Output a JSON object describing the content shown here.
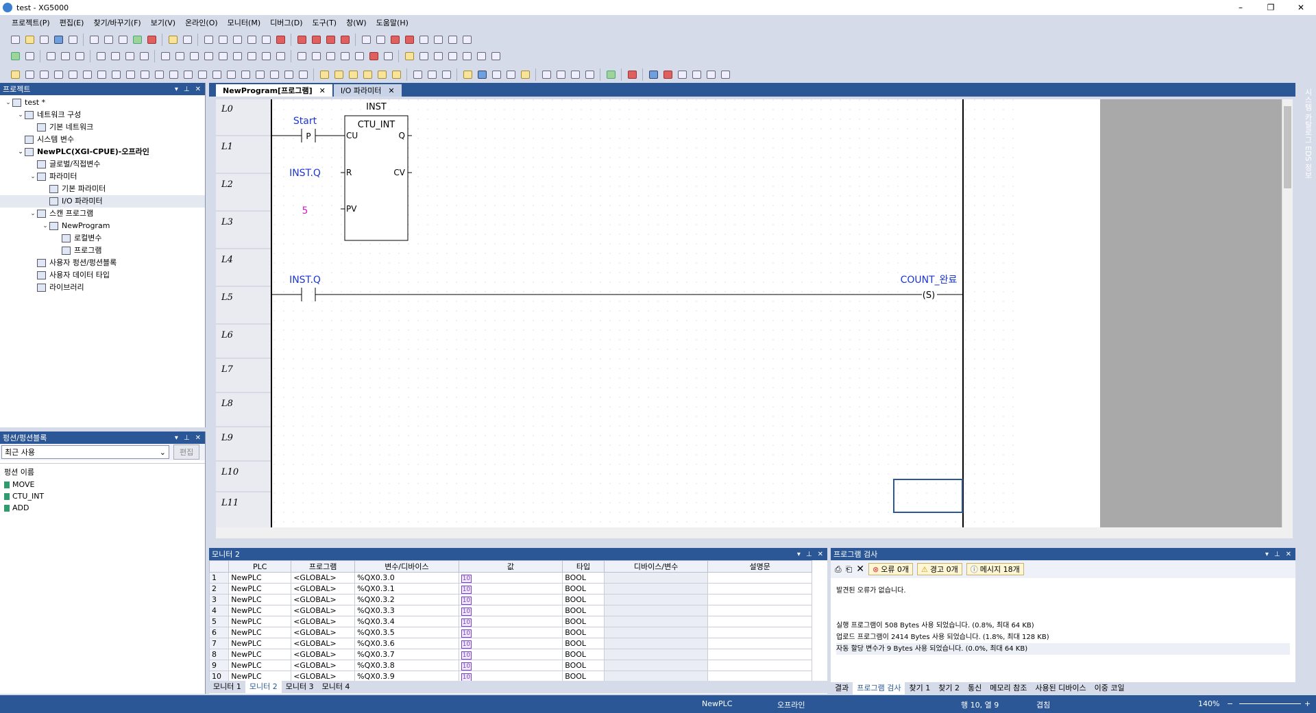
{
  "window": {
    "title": "test - XG5000",
    "controls": [
      "–",
      "❐",
      "✕"
    ]
  },
  "menu": [
    "프로젝트(P)",
    "편집(E)",
    "찾기/바꾸기(F)",
    "보기(V)",
    "온라인(O)",
    "모니터(M)",
    "디버그(D)",
    "도구(T)",
    "창(W)",
    "도움말(H)"
  ],
  "project_panel": {
    "title": "프로젝트",
    "tree": [
      {
        "label": "test *",
        "level": 0,
        "exp": "⌄"
      },
      {
        "label": "네트워크 구성",
        "level": 1,
        "exp": "⌄"
      },
      {
        "label": "기본 네트워크",
        "level": 2,
        "exp": ""
      },
      {
        "label": "시스템 변수",
        "level": 1,
        "exp": ""
      },
      {
        "label": "NewPLC(XGI-CPUE)-오프라인",
        "level": 1,
        "exp": "⌄",
        "bold": true
      },
      {
        "label": "글로벌/직접변수",
        "level": 2,
        "exp": ""
      },
      {
        "label": "파라미터",
        "level": 2,
        "exp": "⌄"
      },
      {
        "label": "기본 파라미터",
        "level": 3,
        "exp": ""
      },
      {
        "label": "I/O 파라미터",
        "level": 3,
        "exp": ""
      },
      {
        "label": "스캔 프로그램",
        "level": 2,
        "exp": "⌄"
      },
      {
        "label": "NewProgram",
        "level": 3,
        "exp": "⌄"
      },
      {
        "label": "로컬변수",
        "level": 4,
        "exp": ""
      },
      {
        "label": "프로그램",
        "level": 4,
        "exp": ""
      },
      {
        "label": "사용자 펑션/펑션블록",
        "level": 2,
        "exp": ""
      },
      {
        "label": "사용자 데이터 타입",
        "level": 2,
        "exp": ""
      },
      {
        "label": "라이브러리",
        "level": 2,
        "exp": ""
      }
    ]
  },
  "func_panel": {
    "title": "펑션/펑션블록",
    "combo": "최근 사용",
    "edit_btn": "편집",
    "header": "펑션 이름",
    "items": [
      "MOVE",
      "CTU_INT",
      "ADD"
    ]
  },
  "doc_tabs": [
    {
      "label": "NewProgram[프로그램]",
      "active": true
    },
    {
      "label": "I/O 파라미터",
      "active": false
    }
  ],
  "ladder": {
    "lines": [
      "L0",
      "L1",
      "L2",
      "L3",
      "L4",
      "L5",
      "L6",
      "L7",
      "L8",
      "L9",
      "L10",
      "L11"
    ],
    "instance": "INST",
    "fb": "CTU_INT",
    "pins_left": [
      "CU",
      "R",
      "PV"
    ],
    "pins_right": [
      "Q",
      "CV"
    ],
    "contact1": "Start",
    "contact1_type": "P",
    "r_input": "INST.Q",
    "pv_input": "5",
    "contact2": "INST.Q",
    "coil": "COUNT_완료",
    "coil_type": "S"
  },
  "side_tabs": "시스템 카탈로그 EDS 정보",
  "monitor": {
    "title": "모니터 2",
    "columns": [
      "PLC",
      "프로그램",
      "변수/디바이스",
      "값",
      "타입",
      "디바이스/변수",
      "설명문"
    ],
    "rows": [
      [
        "1",
        "NewPLC",
        "<GLOBAL>",
        "%QX0.3.0",
        "10",
        "BOOL"
      ],
      [
        "2",
        "NewPLC",
        "<GLOBAL>",
        "%QX0.3.1",
        "10",
        "BOOL"
      ],
      [
        "3",
        "NewPLC",
        "<GLOBAL>",
        "%QX0.3.2",
        "10",
        "BOOL"
      ],
      [
        "4",
        "NewPLC",
        "<GLOBAL>",
        "%QX0.3.3",
        "10",
        "BOOL"
      ],
      [
        "5",
        "NewPLC",
        "<GLOBAL>",
        "%QX0.3.4",
        "10",
        "BOOL"
      ],
      [
        "6",
        "NewPLC",
        "<GLOBAL>",
        "%QX0.3.5",
        "10",
        "BOOL"
      ],
      [
        "7",
        "NewPLC",
        "<GLOBAL>",
        "%QX0.3.6",
        "10",
        "BOOL"
      ],
      [
        "8",
        "NewPLC",
        "<GLOBAL>",
        "%QX0.3.7",
        "10",
        "BOOL"
      ],
      [
        "9",
        "NewPLC",
        "<GLOBAL>",
        "%QX0.3.8",
        "10",
        "BOOL"
      ],
      [
        "10",
        "NewPLC",
        "<GLOBAL>",
        "%QX0.3.9",
        "10",
        "BOOL"
      ]
    ],
    "tabs": [
      "모니터 1",
      "모니터 2",
      "모니터 3",
      "모니터 4"
    ]
  },
  "check": {
    "title": "프로그램 검사",
    "err": "오류 0개",
    "warn": "경고 0개",
    "msg": "메시지 18개",
    "lines": [
      "발견된 오류가 없습니다.",
      "",
      "",
      "실행 프로그램이 508 Bytes 사용 되었습니다. (0.8%, 최대 64 KB)",
      "업로드 프로그램이 2414 Bytes 사용 되었습니다. (1.8%, 최대 128 KB)",
      "자동 할당 변수가 9 Bytes 사용 되었습니다. (0.0%, 최대 64 KB)"
    ],
    "tabs": [
      "결과",
      "프로그램 검사",
      "찾기 1",
      "찾기 2",
      "통신",
      "메모리 참조",
      "사용된 디바이스",
      "이중 코일"
    ]
  },
  "status": {
    "plc": "NewPLC",
    "mode": "오프라인",
    "pos": "행 10, 열 9",
    "edit": "겹침",
    "zoom": "140%"
  }
}
